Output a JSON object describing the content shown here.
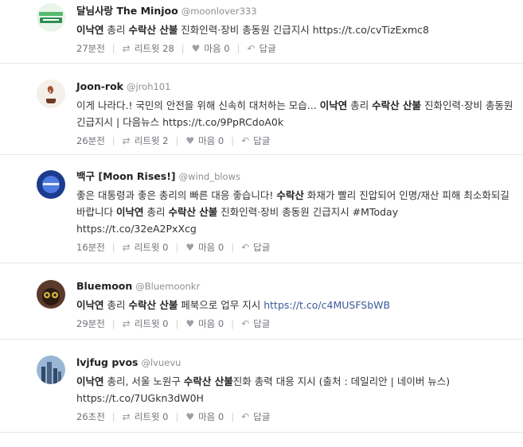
{
  "tweets": [
    {
      "name": "달님사랑 The Minjoo",
      "handle": "@moonlover333",
      "avatar_icon": "minjoo-logo",
      "avatar_colors": [
        "#e9f4ea",
        "#2d8f4e"
      ],
      "parts": [
        {
          "t": "이낙연",
          "b": true
        },
        {
          "t": " 총리 "
        },
        {
          "t": "수락산 산불",
          "b": true
        },
        {
          "t": " 진화인력·장비 총동원 긴급지시 https://t.co/cvTizExmc8"
        }
      ],
      "time": "27분전",
      "retweet": "리트윗 28",
      "like": "마음 0",
      "reply": "답글"
    },
    {
      "name": "Joon-rok",
      "handle": "@jroh101",
      "avatar_icon": "coffee-avatar",
      "avatar_colors": [
        "#f4efe9",
        "#6b3a1f"
      ],
      "parts": [
        {
          "t": "이게 나라다.! 국민의 안전을 위해 신속히 대처하는 모습... "
        },
        {
          "t": "이낙연",
          "b": true
        },
        {
          "t": " 총리 "
        },
        {
          "t": "수락산 산불",
          "b": true
        },
        {
          "t": " 진화인력·장비 총동원 긴급지시 | 다음뉴스 https://t.co/9PpRCdoA0k"
        }
      ],
      "time": "26분전",
      "retweet": "리트윗 2",
      "like": "마음 0",
      "reply": "답글"
    },
    {
      "name": "백구 [Moon Rises!]",
      "handle": "@wind_blows",
      "avatar_icon": "moon-avatar",
      "avatar_colors": [
        "#1c3b8f",
        "#4d7be0"
      ],
      "parts": [
        {
          "t": "좋은 대통령과 좋은 총리의 빠른 대응 좋습니다! "
        },
        {
          "t": "수락산",
          "b": true
        },
        {
          "t": " 화재가 빨리 진압되어 인명/재산 피해 최소화되길 바랍니다 "
        },
        {
          "t": "이낙연",
          "b": true
        },
        {
          "t": " 총리 "
        },
        {
          "t": "수락산 산불",
          "b": true
        },
        {
          "t": " 진화인력·장비 총동원 긴급지시 #MToday https://t.co/32eA2PxXcg"
        }
      ],
      "time": "16분전",
      "retweet": "리트윗 0",
      "like": "마음 0",
      "reply": "답글"
    },
    {
      "name": "Bluemoon",
      "handle": "@Bluemoonkr",
      "avatar_icon": "monster-avatar",
      "avatar_colors": [
        "#5a3a2a",
        "#d8b040"
      ],
      "parts": [
        {
          "t": "이낙연",
          "b": true
        },
        {
          "t": " 총리 "
        },
        {
          "t": "수락산 산불",
          "b": true
        },
        {
          "t": " 페북으로 업무 지시 "
        },
        {
          "t": "https://t.co/c4MUSFSbWB",
          "link": true
        }
      ],
      "time": "29분전",
      "retweet": "리트윗 0",
      "like": "마음 0",
      "reply": "답글"
    },
    {
      "name": "lvjfug pvos",
      "handle": "@lvuevu",
      "avatar_icon": "city-avatar",
      "avatar_colors": [
        "#9ab6d6",
        "#334a66"
      ],
      "parts": [
        {
          "t": "이낙연",
          "b": true
        },
        {
          "t": " 총리, 서울 노원구 "
        },
        {
          "t": "수락산 산불",
          "b": true
        },
        {
          "t": "진화 총력 대응 지시 (출처 : 데일리안 | 네이버 뉴스) https://t.co/7UGkn3dW0H"
        }
      ],
      "time": "26초전",
      "retweet": "리트윗 0",
      "like": "마음 0",
      "reply": "답글"
    }
  ]
}
